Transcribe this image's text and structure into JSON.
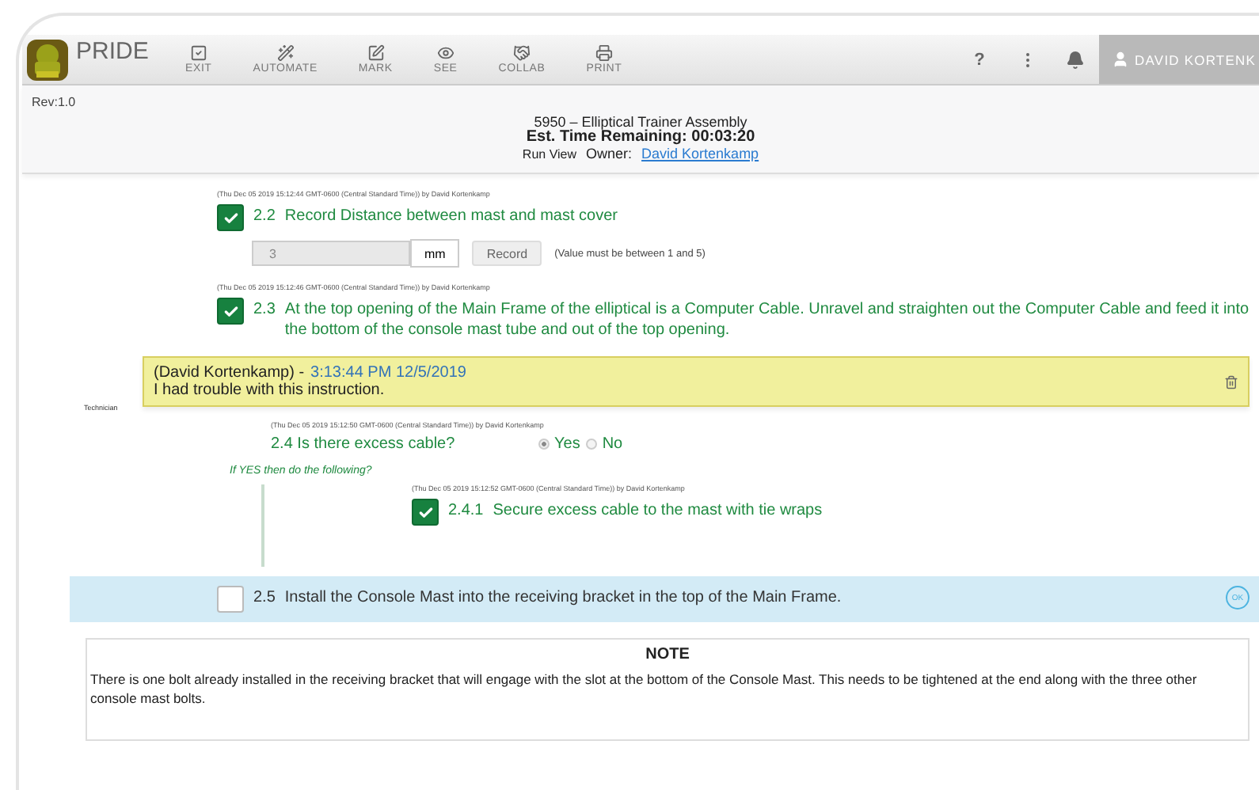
{
  "toolbar": {
    "app_name": "PRIDE",
    "tools": [
      {
        "label": "EXIT"
      },
      {
        "label": "AUTOMATE"
      },
      {
        "label": "MARK"
      },
      {
        "label": "SEE"
      },
      {
        "label": "COLLAB"
      },
      {
        "label": "PRINT"
      }
    ],
    "help": "?",
    "user": "DAVID KORTENK"
  },
  "header": {
    "revision": "Rev:1.0",
    "title": "5950 – Elliptical Trainer Assembly",
    "time": "Est. Time Remaining: 00:03:20",
    "view": "Run View",
    "owner_label": "Owner:",
    "owner": "David Kortenkamp"
  },
  "steps": [
    {
      "kind": "measure",
      "timestamp": "(Thu Dec 05 2019 15:12:44 GMT-0600 (Central Standard Time)) by David Kortenkamp",
      "checked": true,
      "number": "2.2",
      "text": "Record Distance between mast and mast cover",
      "value": "3",
      "unit": "mm",
      "button": "Record",
      "hint": "(Value must be between 1 and 5)"
    },
    {
      "kind": "instruction",
      "timestamp": "(Thu Dec 05 2019 15:12:46 GMT-0600 (Central Standard Time)) by David Kortenkamp",
      "checked": true,
      "active": false,
      "number": "2.3",
      "text": "At the top opening of the Main Frame of the elliptical is a Computer Cable. Unravel and straighten out the Computer Cable and feed it into the bottom of the console mast tube and out of the top opening."
    },
    {
      "kind": "comment",
      "author": "(David Kortenkamp) -",
      "time": "3:13:44 PM 12/5/2019",
      "text": "I had trouble with this instruction.",
      "role": "Technician"
    },
    {
      "kind": "question",
      "timestamp": "(Thu Dec 05 2019 15:12:50 GMT-0600 (Central Standard Time)) by David Kortenkamp",
      "text": "2.4 Is there excess cable?",
      "options": [
        {
          "label": "Yes",
          "selected": true
        },
        {
          "label": "No",
          "selected": false
        }
      ]
    },
    {
      "kind": "conditional",
      "prompt": "If YES then do the following?",
      "children": [
        {
          "kind": "instruction",
          "timestamp": "(Thu Dec 05 2019 15:12:52 GMT-0600 (Central Standard Time)) by David Kortenkamp",
          "checked": true,
          "active": false,
          "number": "2.4.1",
          "text": "Secure excess cable to the mast with tie wraps"
        }
      ]
    },
    {
      "kind": "instruction",
      "checked": false,
      "active": true,
      "number": "2.5",
      "text": "Install the Console Mast into the receiving bracket in the top of the Main Frame.",
      "badge": "OK"
    },
    {
      "kind": "note",
      "title": "NOTE",
      "text": "There is one bolt already installed in the receiving bracket that will engage with the slot at the bottom of the Console Mast. This needs to be tightened at the end along with the three other console mast bolts."
    }
  ]
}
